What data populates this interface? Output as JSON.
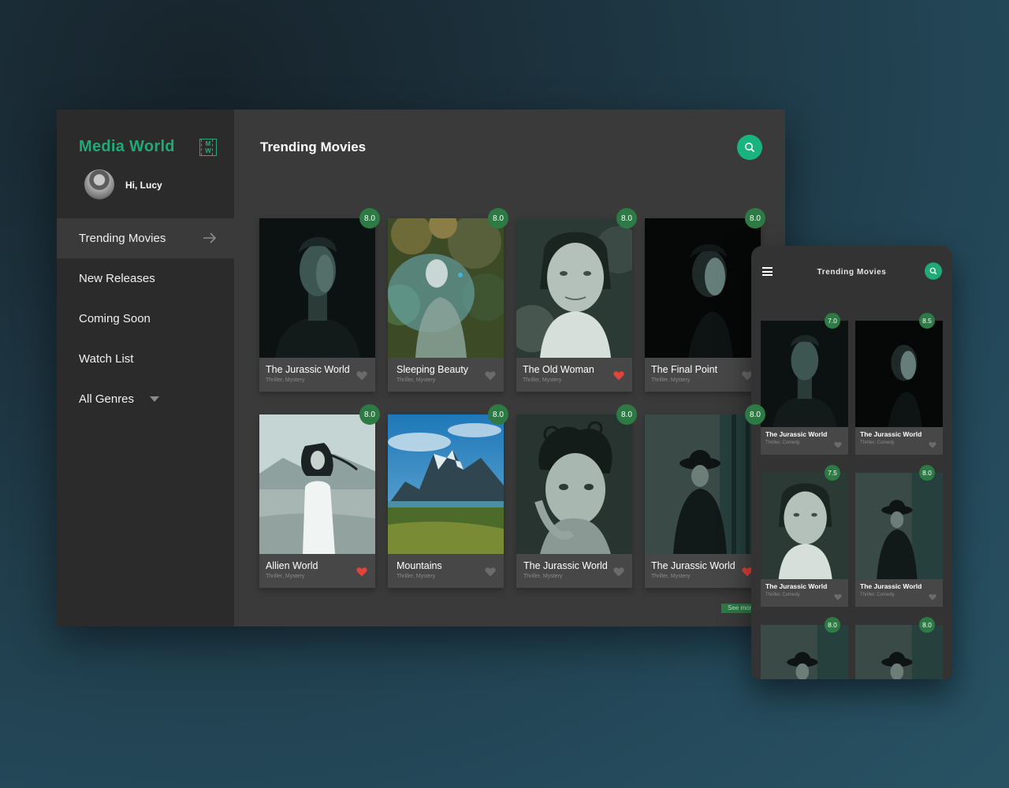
{
  "app": {
    "brand": "Media World",
    "logo_text": [
      "M",
      "W"
    ],
    "greeting": "Hi, Lucy"
  },
  "sidebar": {
    "items": [
      {
        "label": "Trending Movies",
        "active": true,
        "icon": "arrow-right-icon"
      },
      {
        "label": "New Releases"
      },
      {
        "label": "Coming Soon"
      },
      {
        "label": "Watch List"
      },
      {
        "label": "All Genres",
        "icon": "caret-down-icon"
      }
    ]
  },
  "main": {
    "title": "Trending Movies",
    "search_icon": "search-icon",
    "see_more": "See more",
    "movies": [
      {
        "title": "The Jurassic  World",
        "genre": "Thriller, Mystery",
        "rating": "8.0",
        "liked": false
      },
      {
        "title": "Sleeping Beauty",
        "genre": "Thriller, Mystery",
        "rating": "8.0",
        "liked": false
      },
      {
        "title": "The Old Woman",
        "genre": "Thriller, Mystery",
        "rating": "8.0",
        "liked": true
      },
      {
        "title": "The Final Point",
        "genre": "Thriller, Mystery",
        "rating": "8.0",
        "liked": false
      },
      {
        "title": "Allien World",
        "genre": "Thriller, Mystery",
        "rating": "8.0",
        "liked": true
      },
      {
        "title": "Mountains",
        "genre": "Thriller, Mystery",
        "rating": "8.0",
        "liked": false
      },
      {
        "title": "The Jurassic  World",
        "genre": "Thriller, Mystery",
        "rating": "8.0",
        "liked": false
      },
      {
        "title": "The Jurassic  World",
        "genre": "Thriller, Mystery",
        "rating": "8.0",
        "liked": true
      }
    ]
  },
  "phone": {
    "title": "Trending Movies",
    "menu_icon": "hamburger-menu-icon",
    "search_icon": "search-icon",
    "movies": [
      {
        "title": "The Jurassic World",
        "genre": "Thriller, Comedy",
        "rating": "7.0"
      },
      {
        "title": "The Jurassic World",
        "genre": "Thriller, Comedy",
        "rating": "8.5"
      },
      {
        "title": "The Jurassic World",
        "genre": "Thriller, Comedy",
        "rating": "7.5"
      },
      {
        "title": "The Jurassic World",
        "genre": "Thriller, Comedy",
        "rating": "8.0"
      },
      {
        "rating": "8.0"
      },
      {
        "rating": "8.0"
      }
    ]
  },
  "colors": {
    "accent": "#1faa78",
    "badge": "#2d7a45",
    "heart_liked": "#e0443a",
    "heart_default": "#6b6b6b"
  }
}
